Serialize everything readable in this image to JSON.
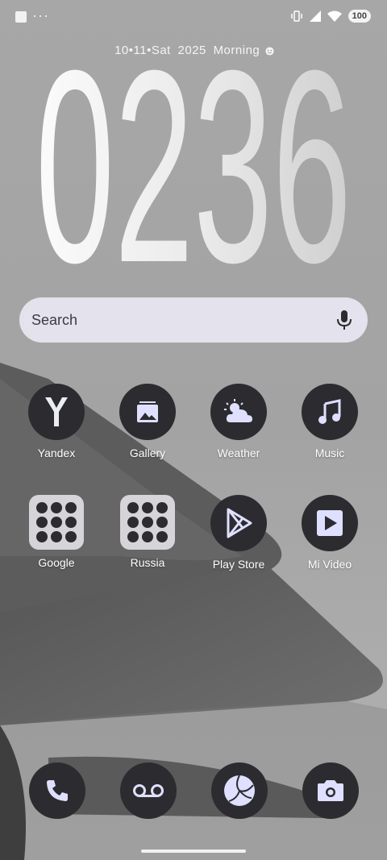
{
  "status_bar": {
    "battery": "100",
    "left_icons": [
      "square-icon",
      "more-dots-icon"
    ],
    "right_icons": [
      "vibrate-icon",
      "signal-icon",
      "wifi-icon",
      "battery-icon"
    ]
  },
  "date_widget": {
    "date": "10•11•Sat",
    "year": "2025",
    "greeting": "Morning",
    "greeting_icon": "smiley-icon",
    "time": "0236"
  },
  "search": {
    "placeholder": "Search",
    "mic_icon": "mic-icon"
  },
  "apps_row1": [
    {
      "label": "Yandex",
      "icon": "yandex-icon"
    },
    {
      "label": "Gallery",
      "icon": "gallery-icon"
    },
    {
      "label": "Weather",
      "icon": "weather-icon"
    },
    {
      "label": "Music",
      "icon": "music-icon"
    }
  ],
  "apps_row2": [
    {
      "label": "Google",
      "icon": "folder-icon"
    },
    {
      "label": "Russia",
      "icon": "folder-icon"
    },
    {
      "label": "Play Store",
      "icon": "play-store-icon"
    },
    {
      "label": "Mi Video",
      "icon": "mi-video-icon"
    }
  ],
  "dock": [
    {
      "icon": "phone-icon"
    },
    {
      "icon": "voicemail-icon"
    },
    {
      "icon": "volleyball-icon"
    },
    {
      "icon": "camera-icon"
    }
  ],
  "colors": {
    "icon_bg": "#2c2c30",
    "icon_fg": "#dfe0ff",
    "search_bg": "#e4e2ec"
  }
}
